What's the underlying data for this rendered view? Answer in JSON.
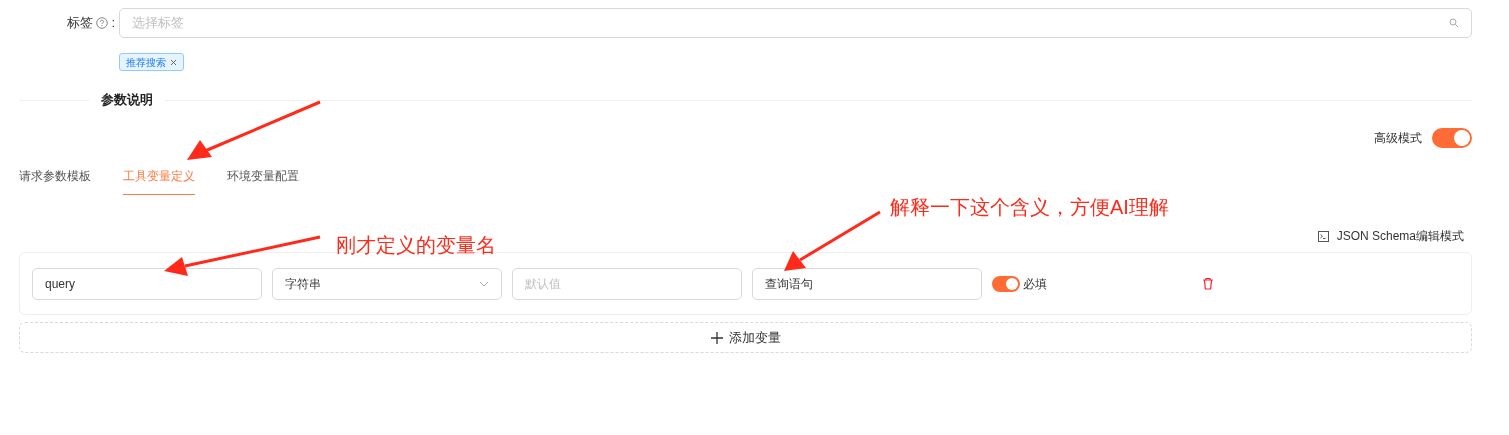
{
  "tags_field": {
    "label": "标签",
    "colon": ":",
    "placeholder": "选择标签",
    "selected_tags": [
      "推荐搜索"
    ]
  },
  "section": {
    "title": "参数说明"
  },
  "advanced_mode": {
    "label": "高级模式",
    "on": true
  },
  "tabs": [
    {
      "label": "请求参数模板",
      "selected": false
    },
    {
      "label": "工具变量定义",
      "selected": true
    },
    {
      "label": "环境变量配置",
      "selected": false
    }
  ],
  "schema_button": {
    "label": "JSON Schema编辑模式"
  },
  "variables": [
    {
      "name": "query",
      "type": "字符串",
      "default_placeholder": "默认值",
      "description": "查询语句",
      "required": true,
      "required_label": "必填"
    }
  ],
  "add_button": {
    "label": "添加变量"
  },
  "annotations": [
    {
      "text": "刚才定义的变量名"
    },
    {
      "text": "解释一下这个含义，方便AI理解"
    }
  ]
}
